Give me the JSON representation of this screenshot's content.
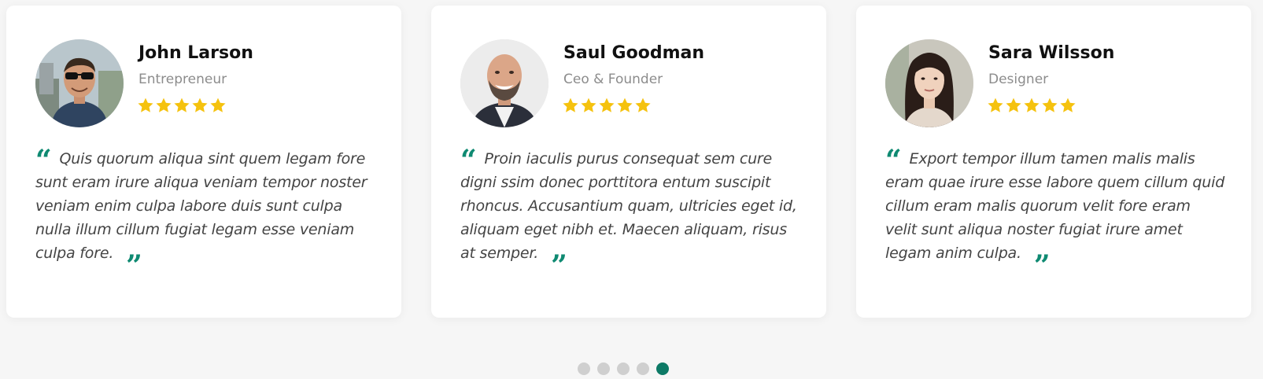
{
  "colors": {
    "accent": "#0f8a72",
    "star": "#f5c20e",
    "dot_inactive": "#cfcfcf",
    "dot_active": "#0d7a66"
  },
  "testimonials": [
    {
      "name": "John Larson",
      "role": "Entrepreneur",
      "rating": 5,
      "quote": "Quis quorum aliqua sint quem legam fore sunt eram irure aliqua veniam tempor noster veniam enim culpa labore duis sunt culpa nulla illum cillum fugiat legam esse veniam culpa fore."
    },
    {
      "name": "Saul Goodman",
      "role": "Ceo & Founder",
      "rating": 5,
      "quote": "Proin iaculis purus consequat sem cure digni ssim donec porttitora entum suscipit rhoncus. Accusantium quam, ultricies eget id, aliquam eget nibh et. Maecen aliquam, risus at semper."
    },
    {
      "name": "Sara Wilsson",
      "role": "Designer",
      "rating": 5,
      "quote": "Export tempor illum tamen malis malis eram quae irure esse labore quem cillum quid cillum eram malis quorum velit fore eram velit sunt aliqua noster fugiat irure amet legam anim culpa."
    }
  ],
  "pagination": {
    "total": 5,
    "active_index": 4
  }
}
